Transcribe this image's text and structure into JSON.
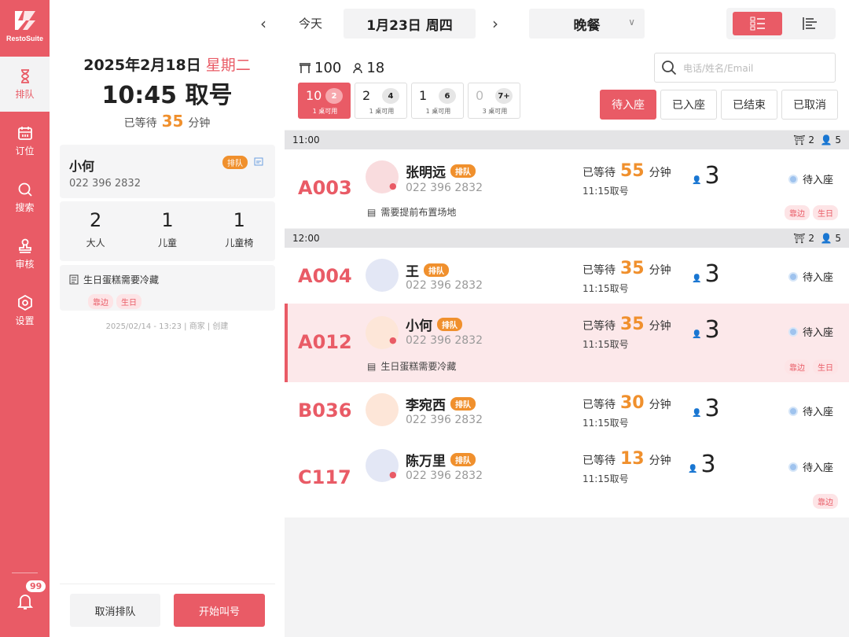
{
  "app": {
    "logo_text": "RestoSuite"
  },
  "nav": [
    {
      "label": "排队",
      "icon": "hourglass-icon"
    },
    {
      "label": "订位",
      "icon": "calendar-icon"
    },
    {
      "label": "搜索",
      "icon": "search-icon"
    },
    {
      "label": "审核",
      "icon": "stamp-icon"
    },
    {
      "label": "设置",
      "icon": "gear-icon"
    }
  ],
  "notifications": {
    "count": "99"
  },
  "left": {
    "date": "2025年2月18日",
    "weekday": "星期二",
    "time_title": "10:45 取号",
    "waited_prefix": "已等待",
    "waited_value": "35",
    "waited_unit": "分钟",
    "guest": {
      "name": "小何",
      "tag": "排队",
      "phone": "022 396 2832"
    },
    "counts": [
      {
        "n": "2",
        "label": "大人"
      },
      {
        "n": "1",
        "label": "儿童"
      },
      {
        "n": "1",
        "label": "儿童椅"
      }
    ],
    "note": "生日蛋糕需要冷藏",
    "tags": [
      "靠边",
      "生日"
    ],
    "meta": "2025/02/14 - 13:23  |  商家  |  创建",
    "cancel_label": "取消排队",
    "start_label": "开始叫号"
  },
  "topbar": {
    "today_label": "今天",
    "date_label": "1月23日 周四",
    "meal_label": "晚餐"
  },
  "summary": {
    "tables": "100",
    "guests": "18"
  },
  "search": {
    "placeholder": "电话/姓名/Email"
  },
  "table_chips": [
    {
      "num": "10",
      "size": "2",
      "sub": "1 桌可用"
    },
    {
      "num": "2",
      "size": "4",
      "sub": "1 桌可用"
    },
    {
      "num": "1",
      "size": "6",
      "sub": "1 桌可用"
    },
    {
      "num": "0",
      "size": "7+",
      "sub": "3 桌可用"
    }
  ],
  "status_tabs": [
    "待入座",
    "已入座",
    "已结束",
    "已取消"
  ],
  "groups": [
    {
      "time": "11:00",
      "tables": "2",
      "guests": "5"
    },
    {
      "time": "12:00",
      "tables": "2",
      "guests": "5"
    }
  ],
  "rows": [
    {
      "code": "A003",
      "name": "张明远",
      "tag": "排队",
      "phone": "022 396 2832",
      "wait_prefix": "已等待",
      "wait": "55",
      "wait_unit": "分钟",
      "taken": "11:15取号",
      "party": "3",
      "status": "待入座",
      "note": "需要提前布置场地",
      "tags": [
        "靠边",
        "生日"
      ]
    },
    {
      "code": "A004",
      "name": "王",
      "tag": "排队",
      "phone": "022 396 2832",
      "wait_prefix": "已等待",
      "wait": "35",
      "wait_unit": "分钟",
      "taken": "11:15取号",
      "party": "3",
      "status": "待入座"
    },
    {
      "code": "A012",
      "name": "小何",
      "tag": "排队",
      "phone": "022 396 2832",
      "wait_prefix": "已等待",
      "wait": "35",
      "wait_unit": "分钟",
      "taken": "11:15取号",
      "party": "3",
      "status": "待入座",
      "note": "生日蛋糕需要冷藏",
      "tags": [
        "靠边",
        "生日"
      ]
    },
    {
      "code": "B036",
      "name": "李宛西",
      "tag": "排队",
      "phone": "022 396 2832",
      "wait_prefix": "已等待",
      "wait": "30",
      "wait_unit": "分钟",
      "taken": "11:15取号",
      "party": "3",
      "status": "待入座"
    },
    {
      "code": "C117",
      "name": "陈万里",
      "tag": "排队",
      "phone": "022 396 2832",
      "wait_prefix": "已等待",
      "wait": "13",
      "wait_unit": "分钟",
      "taken": "11:15取号",
      "party": "3",
      "status": "待入座",
      "tags": [
        "靠边"
      ]
    }
  ],
  "colors": {
    "accent": "#e95b66",
    "orange": "#f0902d"
  }
}
